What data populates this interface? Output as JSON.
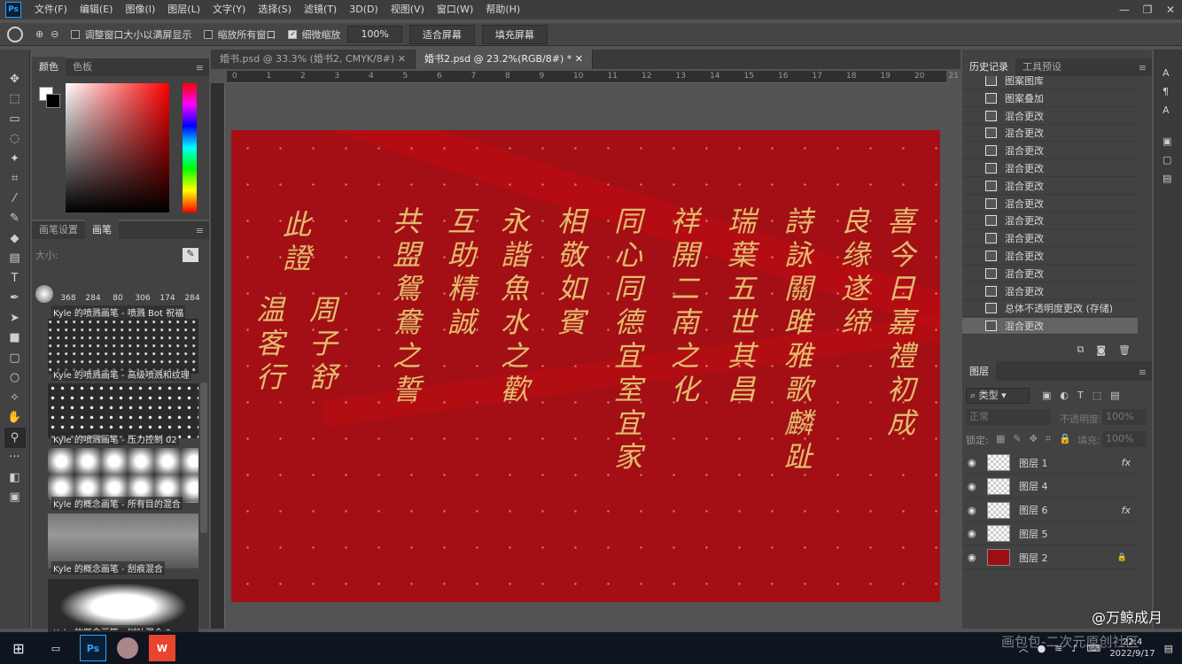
{
  "app": {
    "logo": "Ps"
  },
  "menu": [
    "文件(F)",
    "编辑(E)",
    "图像(I)",
    "图层(L)",
    "文字(Y)",
    "选择(S)",
    "滤镜(T)",
    "3D(D)",
    "视图(V)",
    "窗口(W)",
    "帮助(H)"
  ],
  "options": {
    "resize_window": "调整窗口大小以满屏显示",
    "zoom_all": "缩放所有窗口",
    "scrubby": "细微缩放",
    "zoom_value": "100%",
    "fit_screen": "适合屏幕",
    "fill_screen": "填充屏幕"
  },
  "color_panel": {
    "tab_color": "颜色",
    "tab_swatches": "色板"
  },
  "brush_panel": {
    "tab_settings": "画笔设置",
    "tab_brushes": "画笔",
    "size_label": "大小:",
    "sizes": [
      "368",
      "284",
      "80",
      "306",
      "174",
      "284"
    ],
    "items": [
      "Kyle 的喷溅画笔 - 喷溅 Bot 祝福",
      "Kyle 的喷溅画笔 - 高级喷溅和纹理",
      "Kyle 的喷溅画笔 - 压力控制 02",
      "Kyle 的概念画笔 - 所有目的混合",
      "Kyle 的概念画笔 - 刮痕混合",
      "Kyle 的概念画笔 - 树叶混合 2"
    ]
  },
  "doc_tabs": [
    "婚书.psd @ 33.3% (婚书2, CMYK/8#)",
    "婚书2.psd @ 23.2%(RGB/8#) *"
  ],
  "ruler_h": [
    "0",
    "1",
    "2",
    "3",
    "4",
    "5",
    "6",
    "7",
    "8",
    "9",
    "10",
    "11",
    "12",
    "13",
    "14",
    "15",
    "16",
    "17",
    "18",
    "19",
    "20",
    "21"
  ],
  "canvas": {
    "columns": [
      "喜今日嘉禮初成",
      "良缘遂缔",
      "詩詠關雎雅歌麟趾",
      "瑞葉五世其昌",
      "祥開二南之化",
      "同心同德宜室宜家",
      "相敬如賓",
      "永諧魚水之歡",
      "互助精誠",
      "共盟鴛鴦之誓",
      "此證",
      "周子舒",
      "温客行"
    ]
  },
  "history": {
    "tab_history": "历史记录",
    "tab_presets": "工具预设",
    "items": [
      "图案图库",
      "图案叠加",
      "混合更改",
      "混合更改",
      "混合更改",
      "混合更改",
      "混合更改",
      "混合更改",
      "混合更改",
      "混合更改",
      "混合更改",
      "混合更改",
      "混合更改",
      "总体不透明度更改 (存储)",
      "混合更改"
    ]
  },
  "layers": {
    "tab": "图层",
    "filter": "类型",
    "blend": "正常",
    "opacity_label": "不透明度:",
    "opacity": "100%",
    "lock_label": "锁定:",
    "fill_label": "填充:",
    "fill": "100%",
    "items": [
      {
        "name": "图层 1",
        "fx": "fx"
      },
      {
        "name": "图层 4",
        "fx": ""
      },
      {
        "name": "图层 6",
        "fx": "fx"
      },
      {
        "name": "图层 5",
        "fx": ""
      },
      {
        "name": "图层 2",
        "fx": ""
      }
    ],
    "layer2_color": "#9b0f14"
  },
  "watermark": "@万鲸成月",
  "watermark2": "画包包-二次元原创社区",
  "taskbar": {
    "time": "22:4",
    "date": "2022/9/17"
  }
}
